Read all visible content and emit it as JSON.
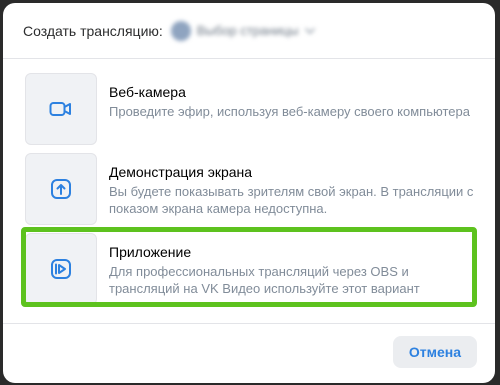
{
  "header": {
    "label": "Создать трансляцию:",
    "page_name": "Выбор страницы"
  },
  "options": [
    {
      "title": "Веб-камера",
      "description": "Проведите эфир, используя веб-камеру своего компьютера",
      "icon": "camera-icon"
    },
    {
      "title": "Демонстрация экрана",
      "description": "Вы будете показывать зрителям свой экран. В трансляции с показом экрана камера недоступна.",
      "icon": "screen-share-icon"
    },
    {
      "title": "Приложение",
      "description": "Для профессиональных трансляций через OBS и трансляций на VK Видео используйте этот вариант",
      "icon": "app-play-icon",
      "highlighted": true
    }
  ],
  "footer": {
    "cancel_label": "Отмена"
  },
  "colors": {
    "accent": "#2d81e0",
    "highlight": "#5dc21e",
    "tile_bg": "#f0f2f5",
    "secondary_text": "#818c99"
  }
}
